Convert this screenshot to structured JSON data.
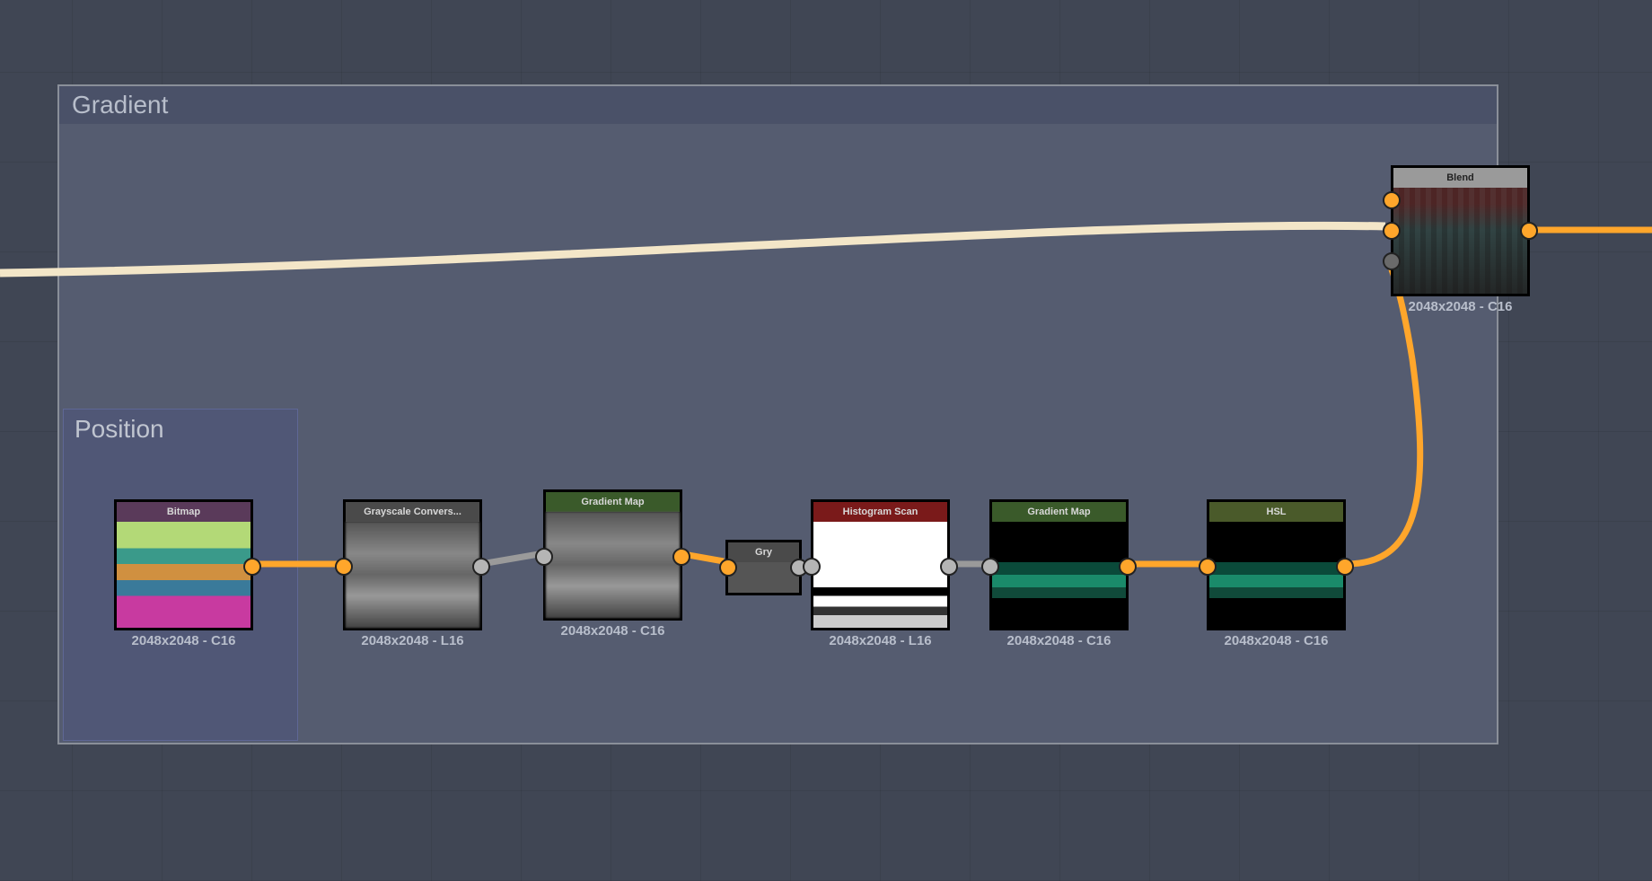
{
  "frame": {
    "title": "Gradient"
  },
  "subframe": {
    "title": "Position"
  },
  "nodes": {
    "bitmap": {
      "title": "Bitmap",
      "caption": "2048x2048 - C16"
    },
    "grayscale": {
      "title": "Grayscale Convers...",
      "caption": "2048x2048 - L16"
    },
    "gradmap1": {
      "title": "Gradient Map",
      "caption": "2048x2048 - C16"
    },
    "gry": {
      "title": "Gry"
    },
    "histogram": {
      "title": "Histogram Scan",
      "caption": "2048x2048 - L16"
    },
    "gradmap2": {
      "title": "Gradient Map",
      "caption": "2048x2048 - C16"
    },
    "hsl": {
      "title": "HSL",
      "caption": "2048x2048 - C16"
    },
    "blend": {
      "title": "Blend",
      "caption": "2048x2048 - C16"
    }
  }
}
